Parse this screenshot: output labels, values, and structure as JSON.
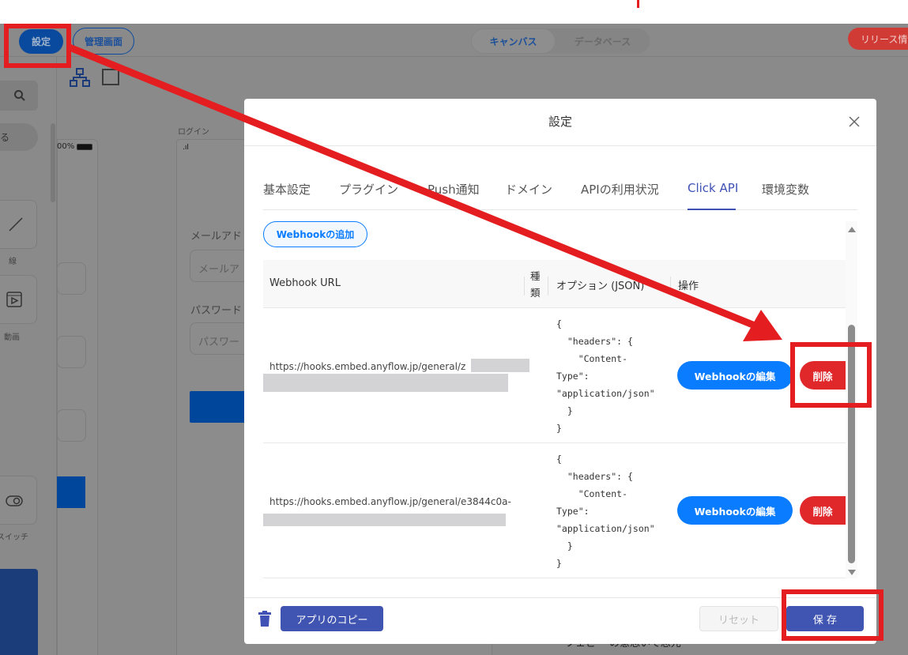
{
  "background": {
    "header": {
      "settings_button": "設定",
      "admin_button": "管理画面",
      "view_tabs": [
        "キャンバス",
        "データベース"
      ],
      "release_button": "リリース情報"
    },
    "sidebar": {
      "search_icon": "search-icon",
      "items": [
        {
          "label": "線",
          "icon": "line-icon"
        },
        {
          "label": "動画",
          "icon": "video-icon"
        },
        {
          "label": "スイッチ",
          "icon": "toggle-icon"
        }
      ],
      "partial_label": "る"
    },
    "canvas": {
      "screen_label": "ログイン",
      "battery_text": "00%",
      "email_label": "メールアド",
      "email_placeholder": "メールア",
      "password_label": "パスワード",
      "password_placeholder": "パスワー",
      "bottom_text": "フェビー の意思いて思元"
    }
  },
  "modal": {
    "title": "設定",
    "close_icon": "close-icon",
    "tabs": [
      {
        "label": "基本設定",
        "active": false
      },
      {
        "label": "プラグイン",
        "active": false
      },
      {
        "label": "Push通知",
        "active": false
      },
      {
        "label": "ドメイン",
        "active": false
      },
      {
        "label": "APIの利用状況",
        "active": false
      },
      {
        "label": "Click API",
        "active": true
      },
      {
        "label": "環境変数",
        "active": false
      }
    ],
    "add_webhook_button": "Webhookの追加",
    "table": {
      "headers": [
        "Webhook URL",
        "種類",
        "オプション (JSON)",
        "操作"
      ],
      "rows": [
        {
          "url": "https://hooks.embed.anyflow.jp/general/z",
          "options": "{\n  \"headers\": {\n    \"Content-\nType\":\n\"application/json\"\n  }\n}",
          "edit_label": "Webhookの編集",
          "delete_label": "削除"
        },
        {
          "url": "https://hooks.embed.anyflow.jp/general/e3844c0a-",
          "options": "{\n  \"headers\": {\n    \"Content-\nType\":\n\"application/json\"\n  }\n}",
          "edit_label": "Webhookの編集",
          "delete_label": "削除"
        }
      ]
    },
    "footer": {
      "copy_app_button": "アプリのコピー",
      "reset_button": "リセット",
      "save_button": "保 存"
    }
  },
  "colors": {
    "accent": "#3f51b5",
    "primary_blue": "#0a7cff",
    "danger": "#e0282b",
    "annotation": "#e41e20"
  }
}
